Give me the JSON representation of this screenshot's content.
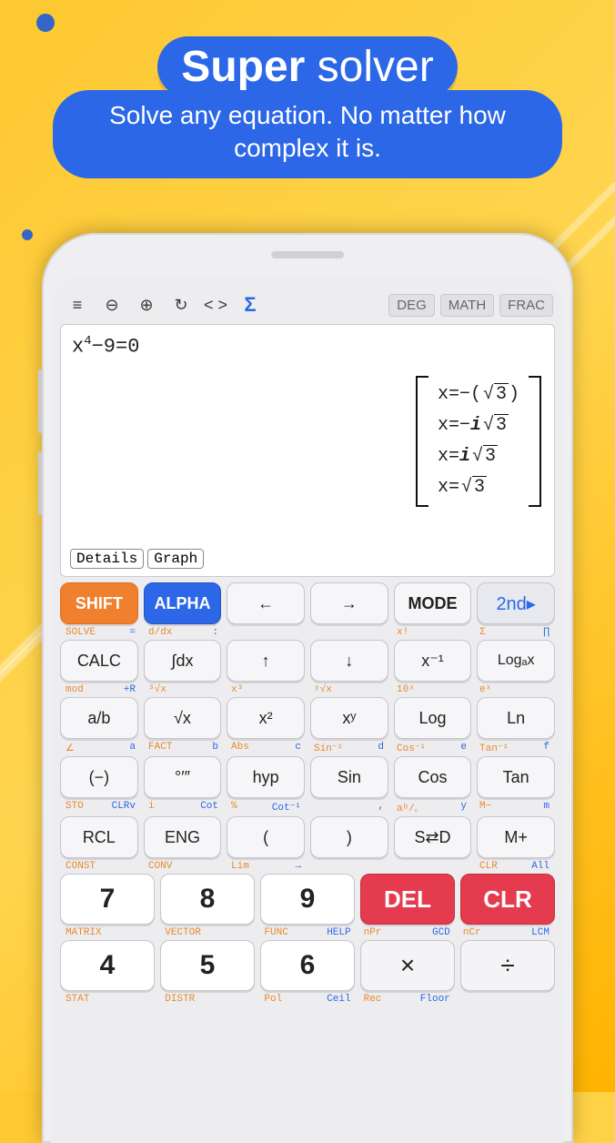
{
  "promo": {
    "title_bold": "Super",
    "title_rest": " solver",
    "subtitle": "Solve any equation. No matter how complex it is."
  },
  "toolbar": {
    "menu": "≡",
    "zoom_out": "⊖",
    "zoom_in": "⊕",
    "refresh": "↻",
    "code": "< >",
    "sigma": "Σ",
    "chips": [
      "DEG",
      "MATH",
      "FRAC"
    ]
  },
  "display": {
    "equation_base": "x",
    "equation_exp": "4",
    "equation_rest": "−9=0",
    "solutions": [
      {
        "pre": "x=−(",
        "sqrt": "3",
        "post": ")"
      },
      {
        "pre": "x=−",
        "i": true,
        "sqrt": "3",
        "post": ""
      },
      {
        "pre": "x=",
        "i": true,
        "sqrt": "3",
        "post": ""
      },
      {
        "pre": "x=",
        "sqrt": "3",
        "post": ""
      }
    ],
    "details_btn": "Details",
    "graph_btn": "Graph"
  },
  "rows": {
    "r1": [
      "SHIFT",
      "ALPHA",
      "←",
      "→",
      "MODE",
      "2nd▸"
    ],
    "h1": [
      [
        "SOLVE",
        "="
      ],
      [
        "d/dx",
        ":"
      ],
      [
        "",
        ""
      ],
      [
        "",
        ""
      ],
      [
        "x!",
        ""
      ],
      [
        "Σ",
        "∏"
      ]
    ],
    "r2": [
      "CALC",
      "∫dx",
      "↑",
      "↓",
      "x⁻¹",
      "Logₐx"
    ],
    "h2": [
      [
        "mod",
        "+R"
      ],
      [
        "³√x",
        ""
      ],
      [
        "x³",
        ""
      ],
      [
        "ʸ√x",
        ""
      ],
      [
        "10ˣ",
        ""
      ],
      [
        "eˣ",
        ""
      ]
    ],
    "r3": [
      "a/b",
      "√x",
      "x²",
      "xʸ",
      "Log",
      "Ln"
    ],
    "h3": [
      [
        "∠",
        "a"
      ],
      [
        "FACT",
        "b"
      ],
      [
        "Abs",
        "c"
      ],
      [
        "Sin⁻¹",
        "d"
      ],
      [
        "Cos⁻¹",
        "e"
      ],
      [
        "Tan⁻¹",
        "f"
      ]
    ],
    "r4": [
      "(−)",
      "°′″",
      "hyp",
      "Sin",
      "Cos",
      "Tan"
    ],
    "h4": [
      [
        "STO",
        "CLRv"
      ],
      [
        "i",
        "Cot"
      ],
      [
        "%",
        "Cot⁻¹"
      ],
      [
        "",
        ","
      ],
      [
        "aᵇ/꜀",
        "y"
      ],
      [
        "M−",
        "m"
      ]
    ],
    "r5": [
      "RCL",
      "ENG",
      "(",
      ")",
      "S⇄D",
      "M+"
    ],
    "h5": [
      [
        "CONST",
        ""
      ],
      [
        "CONV",
        ""
      ],
      [
        "Lim",
        "→"
      ],
      [
        "",
        ""
      ],
      [
        "",
        ""
      ],
      [
        "CLR",
        "All"
      ]
    ],
    "r6": [
      "7",
      "8",
      "9",
      "DEL",
      "CLR"
    ],
    "h6": [
      [
        "MATRIX",
        ""
      ],
      [
        "VECTOR",
        ""
      ],
      [
        "FUNC",
        "HELP"
      ],
      [
        "nPr",
        "GCD"
      ],
      [
        "nCr",
        "LCM"
      ]
    ],
    "r7": [
      "4",
      "5",
      "6",
      "×",
      "÷"
    ],
    "h7": [
      [
        "STAT",
        ""
      ],
      [
        "DISTR",
        ""
      ],
      [
        "Pol",
        "Ceil"
      ],
      [
        "Rec",
        "Floor"
      ],
      [
        "",
        ""
      ]
    ]
  }
}
